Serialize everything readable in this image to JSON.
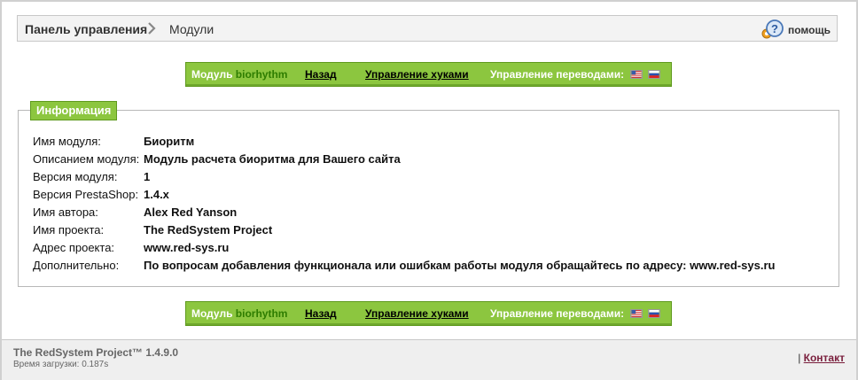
{
  "breadcrumb": {
    "home": "Панель управления",
    "current": "Модули",
    "help_label": "помощь"
  },
  "toolbar": {
    "module_prefix": "Модуль",
    "module_name": "biorhythm",
    "back_label": "Назад",
    "hooks_label": "Управление хуками",
    "translations_label": "Управление переводами:",
    "flags": [
      "flag-us-icon",
      "flag-ru-icon"
    ]
  },
  "info": {
    "legend": "Информация",
    "rows": [
      {
        "label": "Имя модуля:",
        "value": "Биоритм"
      },
      {
        "label": "Описанием модуля:",
        "value": "Модуль расчета биоритма для Вашего сайта"
      },
      {
        "label": "Версия модуля:",
        "value": "1"
      },
      {
        "label": "Версия PrestaShop:",
        "value": "1.4.x"
      },
      {
        "label": "Имя автора:",
        "value": "Alex Red Yanson"
      },
      {
        "label": "Имя проекта:",
        "value": "The RedSystem Project"
      },
      {
        "label": "Адрес проекта:",
        "value": "www.red-sys.ru"
      },
      {
        "label": "Дополнительно:",
        "value": "По вопросам добавления функционала или ошибкам работы модуля обращайтесь по адресу: www.red-sys.ru"
      }
    ]
  },
  "footer": {
    "project": "The RedSystem Project™",
    "version": "1.4.9.0",
    "load_time": "Время загрузки: 0.187s",
    "separator": "|",
    "contact_label": "Контакт"
  },
  "colors": {
    "toolbar_green": "#8cc63f",
    "module_name_green": "#2e7d00",
    "contact_link": "#7a1f3d"
  }
}
